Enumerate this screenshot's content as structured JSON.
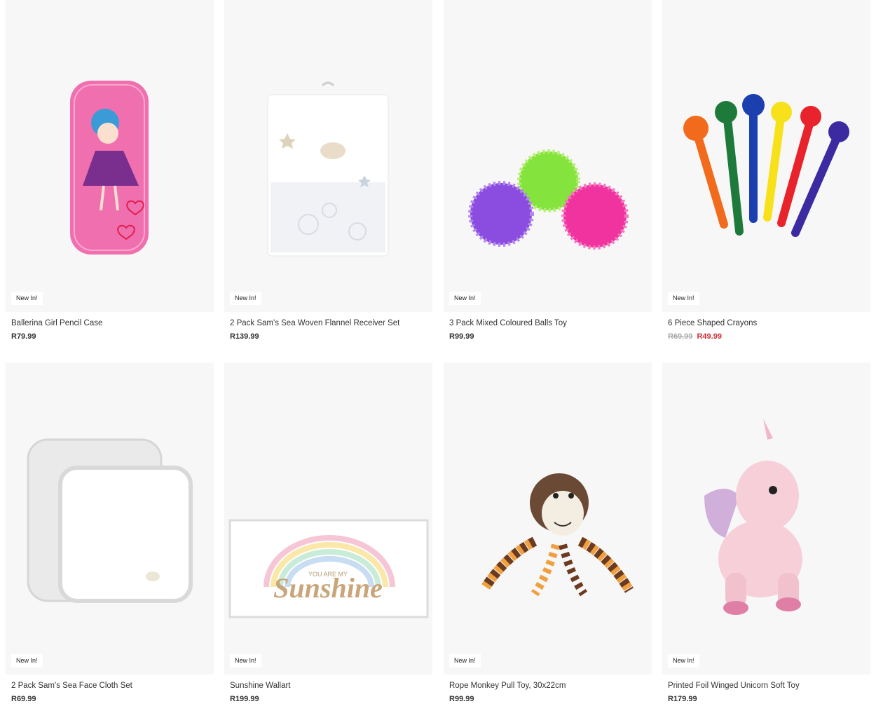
{
  "products": [
    {
      "title": "Ballerina Girl Pencil Case",
      "badge": "New In!",
      "price": "R79.99",
      "image": "ballerina-pencil-case"
    },
    {
      "title": "2 Pack Sam's Sea Woven Flannel Receiver Set",
      "badge": "New In!",
      "price": "R139.99",
      "image": "flannel-receiver-set"
    },
    {
      "title": "3 Pack Mixed Coloured Balls Toy",
      "badge": "New In!",
      "price": "R99.99",
      "image": "spiky-balls"
    },
    {
      "title": "6 Piece Shaped Crayons",
      "badge": "New In!",
      "price_old": "R69.99",
      "price_sale": "R49.99",
      "image": "shaped-crayons"
    },
    {
      "title": "2 Pack Sam's Sea Face Cloth Set",
      "badge": "New In!",
      "price": "R69.99",
      "image": "face-cloths"
    },
    {
      "title": "Sunshine Wallart",
      "badge": "New In!",
      "price": "R199.99",
      "image": "sunshine-wallart",
      "art_text": "Sunshine",
      "art_subtext": "YOU ARE MY"
    },
    {
      "title": "Rope Monkey Pull Toy, 30x22cm",
      "badge": "New In!",
      "price": "R99.99",
      "image": "rope-monkey"
    },
    {
      "title": "Printed Foil Winged Unicorn Soft Toy",
      "badge": "New In!",
      "price": "R179.99",
      "image": "unicorn-soft-toy"
    }
  ],
  "colors": {
    "sale": "#d0303a",
    "tile_bg": "#f7f7f7"
  }
}
